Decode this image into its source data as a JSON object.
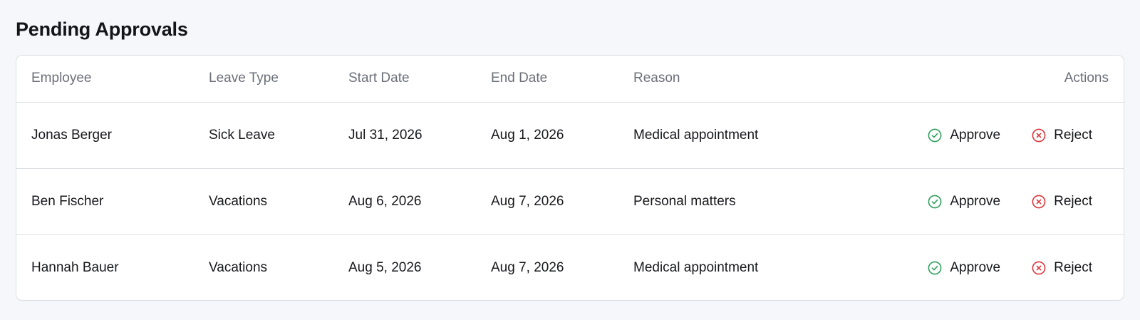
{
  "page": {
    "title": "Pending Approvals"
  },
  "table": {
    "headers": {
      "employee": "Employee",
      "leave_type": "Leave Type",
      "start_date": "Start Date",
      "end_date": "End Date",
      "reason": "Reason",
      "actions": "Actions"
    },
    "rows": [
      {
        "employee": "Jonas Berger",
        "leave_type": "Sick Leave",
        "start_date": "Jul 31, 2026",
        "end_date": "Aug 1, 2026",
        "reason": "Medical appointment",
        "approve_label": "Approve",
        "reject_label": "Reject"
      },
      {
        "employee": "Ben Fischer",
        "leave_type": "Vacations",
        "start_date": "Aug 6, 2026",
        "end_date": "Aug 7, 2026",
        "reason": "Personal matters",
        "approve_label": "Approve",
        "reject_label": "Reject"
      },
      {
        "employee": "Hannah Bauer",
        "leave_type": "Vacations",
        "start_date": "Aug 5, 2026",
        "end_date": "Aug 7, 2026",
        "reason": "Medical appointment",
        "approve_label": "Approve",
        "reject_label": "Reject"
      }
    ]
  },
  "icons": {
    "approve": "check-circle-icon",
    "reject": "x-circle-icon"
  },
  "colors": {
    "approve": "#2f9e5b",
    "reject": "#d9373c",
    "header_text": "#6b6f78",
    "border": "#dcdee3",
    "background": "#f6f7fa"
  }
}
